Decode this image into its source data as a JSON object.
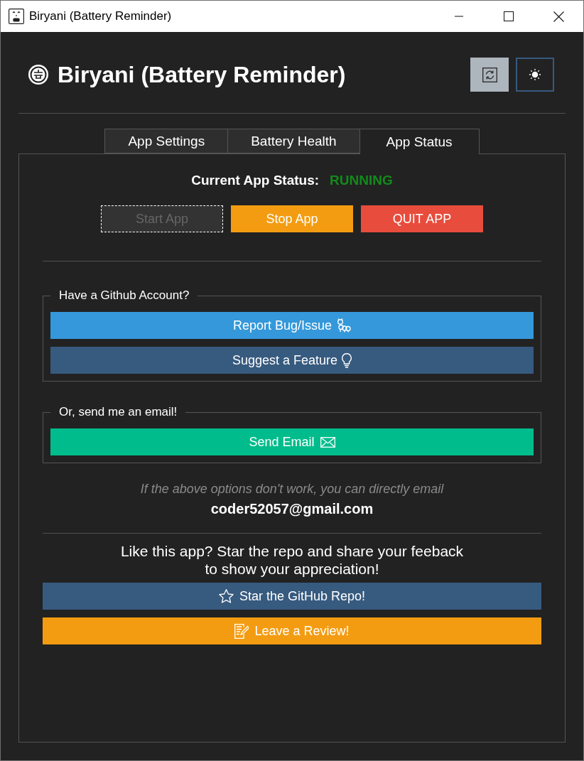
{
  "window": {
    "title": "Biryani (Battery Reminder)"
  },
  "header": {
    "title": "Biryani (Battery Reminder)"
  },
  "tabs": [
    {
      "label": "App Settings",
      "selected": false
    },
    {
      "label": "Battery Health",
      "selected": false
    },
    {
      "label": "App Status",
      "selected": true
    }
  ],
  "status": {
    "label": "Current App Status:",
    "value": "RUNNING",
    "running": true
  },
  "controls": [
    {
      "label": "Start App",
      "kind": "start",
      "disabled": true,
      "focused": true
    },
    {
      "label": "Stop App",
      "kind": "stop",
      "disabled": false,
      "focused": false
    },
    {
      "label": "QUIT APP",
      "kind": "quit",
      "disabled": false,
      "focused": false
    }
  ],
  "groups": [
    {
      "legend": "Have a Github Account?",
      "buttons": [
        {
          "label": "Report Bug/Issue",
          "kind": "bug"
        },
        {
          "label": "Suggest a Feature",
          "kind": "feature"
        }
      ]
    },
    {
      "legend": "Or, send me an email!",
      "buttons": [
        {
          "label": "Send Email",
          "kind": "email"
        }
      ]
    }
  ],
  "email_note": {
    "text": "If the above options don't work, you can directly email",
    "address": "coder52057@gmail.com"
  },
  "appreciation": {
    "text": "Like this app? Star the repo and share your feeback\nto show your appreciation!",
    "buttons": [
      {
        "label": "Star the GitHub Repo!",
        "kind": "star"
      },
      {
        "label": "Leave a Review!",
        "kind": "review"
      }
    ]
  }
}
